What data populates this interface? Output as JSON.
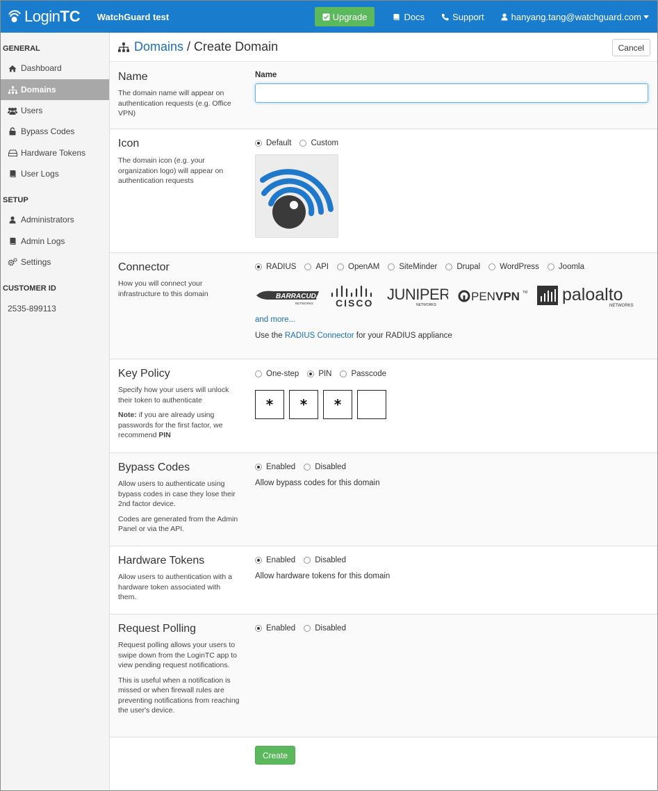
{
  "nav": {
    "brand_a": "Login",
    "brand_b": "TC",
    "org_name": "WatchGuard test",
    "upgrade_label": "Upgrade",
    "docs_label": "Docs",
    "support_label": "Support",
    "user_label": "hanyang.tang@watchguard.com"
  },
  "sidebar": {
    "general_heading": "GENERAL",
    "setup_heading": "SETUP",
    "customer_heading": "CUSTOMER ID",
    "customer_id": "2535-899113",
    "general_items": [
      {
        "label": "Dashboard",
        "icon": "home-icon"
      },
      {
        "label": "Domains",
        "icon": "sitemap-icon",
        "active": true
      },
      {
        "label": "Users",
        "icon": "users-icon"
      },
      {
        "label": "Bypass Codes",
        "icon": "lock-icon"
      },
      {
        "label": "Hardware Tokens",
        "icon": "hdd-icon"
      },
      {
        "label": "User Logs",
        "icon": "book-icon"
      }
    ],
    "setup_items": [
      {
        "label": "Administrators",
        "icon": "user-icon"
      },
      {
        "label": "Admin Logs",
        "icon": "book-icon"
      },
      {
        "label": "Settings",
        "icon": "cogs-icon"
      }
    ]
  },
  "header": {
    "breadcrumb_link": "Domains",
    "separator": "/",
    "current": "Create Domain",
    "cancel_label": "Cancel"
  },
  "name_section": {
    "title": "Name",
    "description": "The domain name will appear on authentication requests (e.g. Office VPN)",
    "field_label": "Name",
    "value": "",
    "placeholder": ""
  },
  "icon_section": {
    "title": "Icon",
    "description": "The domain icon (e.g. your organization logo) will appear on authentication requests",
    "options": [
      "Default",
      "Custom"
    ],
    "selected": "Default"
  },
  "connector_section": {
    "title": "Connector",
    "description": "How you will connect your infrastructure to this domain",
    "options": [
      "RADIUS",
      "API",
      "OpenAM",
      "SiteMinder",
      "Drupal",
      "WordPress",
      "Joomla"
    ],
    "selected": "RADIUS",
    "vendors": [
      "Barracuda",
      "Cisco",
      "Juniper",
      "OpenVPN",
      "Palo Alto"
    ],
    "vendor_logo_text": {
      "barracuda": "BARRACUDA",
      "barracuda_sub": "NETWORKS",
      "cisco": "CISCO",
      "juniper": "JUNIPER",
      "juniper_sub": "NETWORKS",
      "openvpn_a": "PEN",
      "openvpn_b": "VPN",
      "openvpn_tm": "TM",
      "paloalto": "paloalto",
      "paloalto_sub": "NETWORKS"
    },
    "and_more": "and more...",
    "helper_prefix": "Use the",
    "helper_link": "RADIUS Connector",
    "helper_suffix": "for your RADIUS appliance"
  },
  "key_policy_section": {
    "title": "Key Policy",
    "description": "Specify how your users will unlock their token to authenticate",
    "note_bold": "Note:",
    "note_text": "if you are already using passwords for the first factor, we recommend",
    "note_emph": "PIN",
    "options": [
      "One-step",
      "PIN",
      "Passcode"
    ],
    "selected": "PIN",
    "pin_chars": [
      "*",
      "*",
      "*",
      ""
    ]
  },
  "bypass_section": {
    "title": "Bypass Codes",
    "description": "Allow users to authenticate using bypass codes in case they lose their 2nd factor device.",
    "description2": "Codes are generated from the Admin Panel or via the API.",
    "options": [
      "Enabled",
      "Disabled"
    ],
    "selected": "Enabled",
    "helper": "Allow bypass codes for this domain"
  },
  "hardware_section": {
    "title": "Hardware Tokens",
    "description": "Allow users to authentication with a hardware token associated with them.",
    "options": [
      "Enabled",
      "Disabled"
    ],
    "selected": "Enabled",
    "helper": "Allow hardware tokens for this domain"
  },
  "polling_section": {
    "title": "Request Polling",
    "description": "Request polling allows your users to swipe down from the LoginTC app to view pending request notifications.",
    "description2": "This is useful when a notification is missed or when firewall rules are preventing notifications from reaching the user's device.",
    "options": [
      "Enabled",
      "Disabled"
    ],
    "selected": "Enabled"
  },
  "actions": {
    "create_label": "Create"
  },
  "colors": {
    "topbar": "#1a7ccc",
    "success": "#5cb85c",
    "link": "#1a6fb5",
    "sidebar_active": "#a8a8a8"
  }
}
